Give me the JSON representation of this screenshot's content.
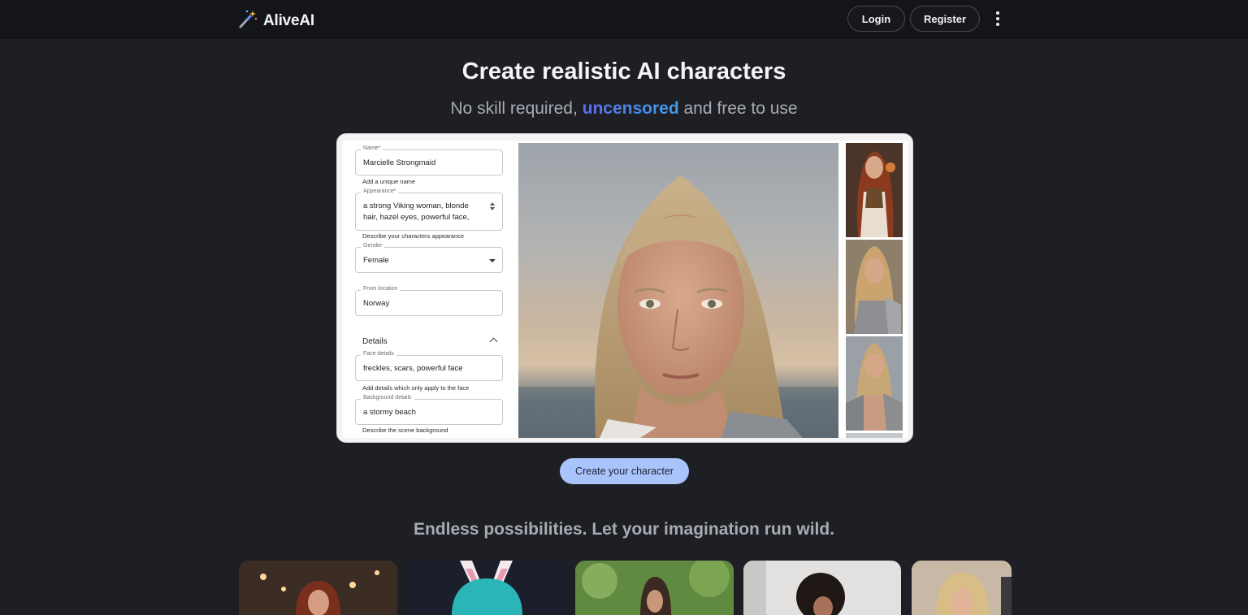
{
  "header": {
    "brand": "AliveAI",
    "login_label": "Login",
    "register_label": "Register",
    "logo_icon": "magic-wand-icon",
    "menu_icon": "kebab-menu-icon"
  },
  "hero": {
    "title": "Create realistic AI characters",
    "subtitle_before": "No skill required, ",
    "subtitle_accent": "uncensored",
    "subtitle_after": " and free to use"
  },
  "preview_form": {
    "name_label": "Name*",
    "name_value": "Marcielle Strongmaid",
    "name_helper": "Add a unique name",
    "appearance_label": "Appearance*",
    "appearance_line1": "a strong Viking woman, blonde",
    "appearance_line2": "hair, hazel eyes, powerful face,",
    "appearance_helper": "Describe your characters appearance",
    "gender_label": "Gender",
    "gender_value": "Female",
    "location_label": "From location",
    "location_value": "Norway",
    "details_heading": "Details",
    "face_label": "Face details",
    "face_value": "freckles, scars, powerful face",
    "face_helper": "Add details which only apply to the face",
    "background_label": "Background details",
    "background_value": "a stormy beach",
    "background_helper": "Describe the scene background"
  },
  "cta_label": "Create your character",
  "gallery": {
    "title": "Endless possibilities. Let your imagination run wild."
  },
  "colors": {
    "page_bg": "#1e1f24",
    "header_bg": "#141519",
    "cta_bg": "#a9c3fb",
    "accent_start": "#5a6cf0",
    "accent_end": "#3da0e8"
  }
}
